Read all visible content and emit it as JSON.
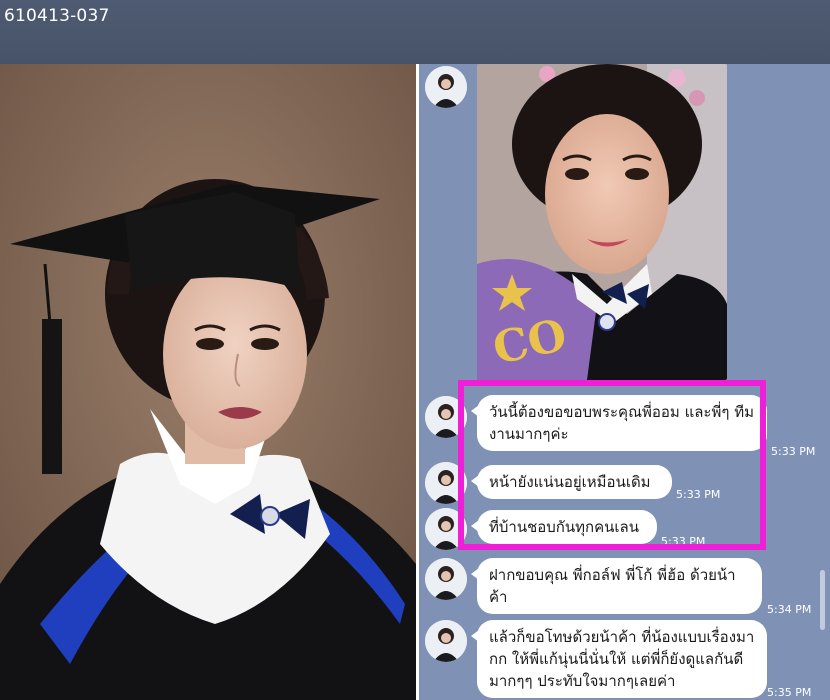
{
  "header": {
    "title": "610413-037"
  },
  "chat": {
    "messages": [
      {
        "text": "วันนี้ต้องขอขอบพระคุณพี่ออม และพี่ๆ ทีมงานมากๆค่ะ",
        "time": "5:33 PM"
      },
      {
        "text": "หน้ายังแน่นอยู่เหมือนเดิม",
        "time": "5:33 PM"
      },
      {
        "text": "ที่บ้านชอบกันทุกคนเลน",
        "time": "5:33 PM"
      },
      {
        "text": "ฝากขอบคุณ พี่กอล์ฟ พี่โก้ พี่ฮ้อ ด้วยน้าค้า",
        "time": "5:34 PM"
      },
      {
        "text": "แล้วก็ขอโทษด้วยน้าค้า ที่น้องแบบเรื่องมากก ให้พี่แก้นุ่นนี่นั่นให้ แต่พี่ก็ยังดูแลกันดีมากๆๆ ประทับใจมากๆเลยค่า",
        "time": "5:35 PM"
      }
    ]
  },
  "colors": {
    "header_bg": "#4e5b72",
    "chat_bg": "#7f92b5",
    "highlight": "#ee1fd7",
    "bubble": "#ffffff"
  }
}
